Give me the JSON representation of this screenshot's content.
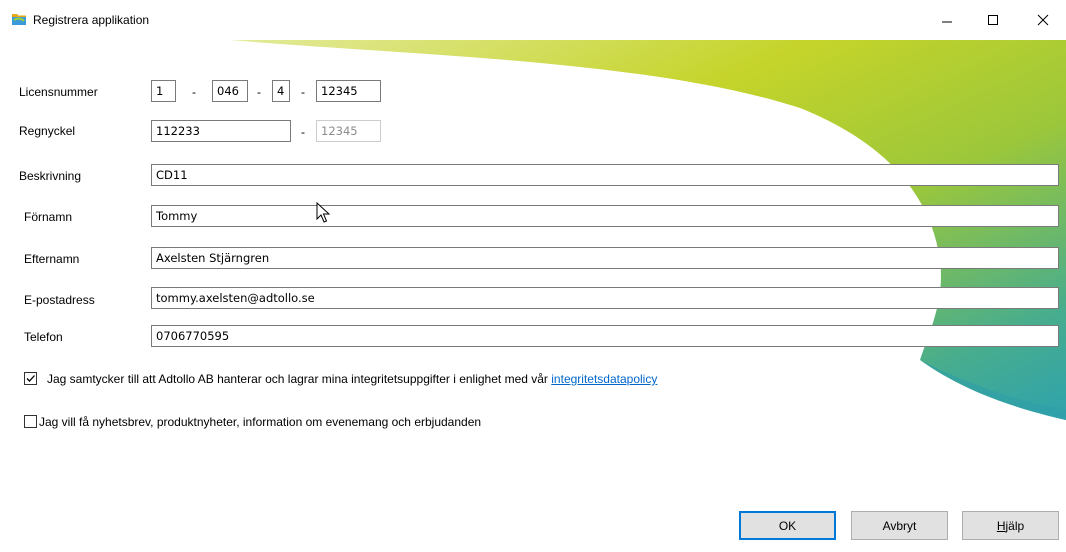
{
  "window": {
    "title": "Registrera applikation",
    "icon": "folder-app-icon"
  },
  "form": {
    "license": {
      "label": "Licensnummer",
      "part1": "1",
      "sep1": "-",
      "part2": "046",
      "sep2": "-",
      "part3": "4",
      "sep3": "-",
      "part4": "12345"
    },
    "regkey": {
      "label": "Regnyckel",
      "part1": "112233",
      "sep": "-",
      "part2": "12345"
    },
    "description": {
      "label": "Beskrivning",
      "value": "CD11"
    },
    "firstname": {
      "label": "Förnamn",
      "value": "Tommy"
    },
    "lastname": {
      "label": "Efternamn",
      "value": "Axelsten Stjärngren"
    },
    "email": {
      "label": "E-postadress",
      "value": "tommy.axelsten@adtollo.se"
    },
    "phone": {
      "label": "Telefon",
      "value": "0706770595"
    }
  },
  "consent": {
    "checked": true,
    "text": "Jag samtycker till att Adtollo AB hanterar och lagrar mina integritetsuppgifter i enlighet med vår ",
    "link": "integritetsdatapolicy"
  },
  "newsletter": {
    "checked": false,
    "text": "Jag vill få nyhetsbrev, produktnyheter, information om evenemang och erbjudanden"
  },
  "buttons": {
    "ok": "OK",
    "cancel": "Avbryt",
    "help": "Hjälp",
    "help_accel": "H",
    "help_rest": "jälp"
  },
  "colors": {
    "accent": "#0078d7",
    "link": "#0066cc",
    "swoosh_green": "#b8cf1e",
    "swoosh_teal": "#3aa9a6"
  }
}
